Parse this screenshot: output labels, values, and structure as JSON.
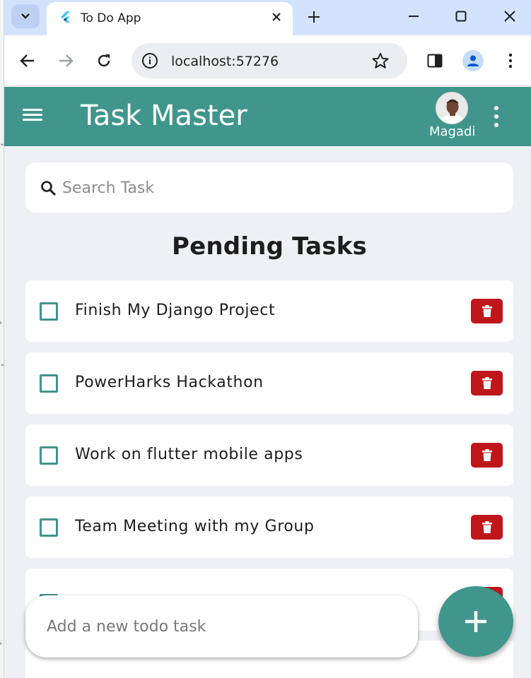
{
  "browser": {
    "tab_title": "To Do App",
    "url": "localhost:57276"
  },
  "app": {
    "title": "Task Master",
    "user_name": "Magadi",
    "search_placeholder": "Search Task",
    "section_title": "Pending Tasks",
    "tasks": [
      {
        "label": "Finish My Django Project",
        "done": false
      },
      {
        "label": "PowerHarks Hackathon",
        "done": false
      },
      {
        "label": "Work on flutter mobile apps",
        "done": false
      },
      {
        "label": "Team Meeting with my Group",
        "done": false
      },
      {
        "label": "",
        "done": false
      }
    ],
    "add_placeholder": "Add a new todo task"
  },
  "colors": {
    "appbar": "#40968c",
    "delete": "#c0161b",
    "background": "#eef0f5",
    "tab_strip": "#d3e3fd"
  }
}
